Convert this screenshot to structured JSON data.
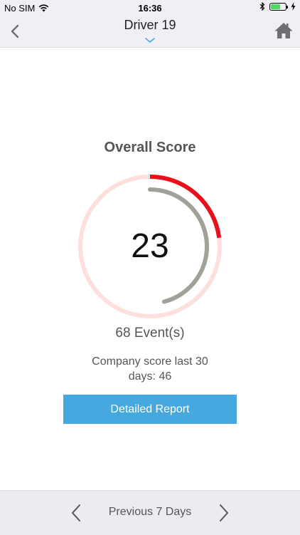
{
  "status_bar": {
    "carrier": "No SIM",
    "time": "16:36"
  },
  "nav": {
    "title": "Driver 19"
  },
  "score": {
    "heading": "Overall Score",
    "value": "23",
    "score_fraction": 0.23,
    "comparison_fraction": 0.46,
    "events": "68 Event(s)",
    "company_score": "Company score last 30 days: 46"
  },
  "actions": {
    "report_label": "Detailed Report"
  },
  "footer": {
    "period_label": "Previous 7 Days"
  },
  "colors": {
    "score_arc": "#e8101a",
    "track": "#fde0dd",
    "comparison_arc": "#a0a198",
    "button": "#45a9e0"
  }
}
